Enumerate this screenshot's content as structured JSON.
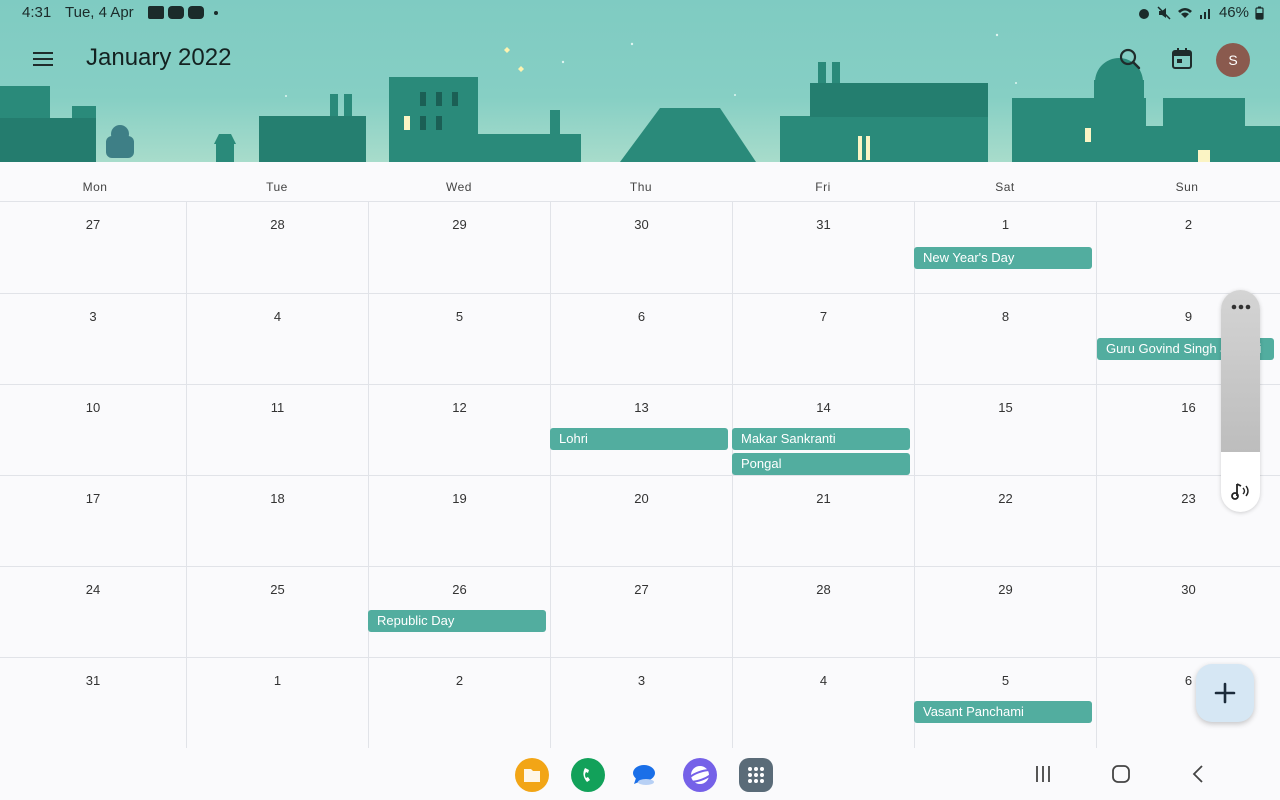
{
  "status_bar": {
    "time": "4:31",
    "date": "Tue, 4 Apr",
    "battery": "46%"
  },
  "header": {
    "title": "January 2022"
  },
  "weekdays": [
    "Mon",
    "Tue",
    "Wed",
    "Thu",
    "Fri",
    "Sat",
    "Sun"
  ],
  "weeks": [
    {
      "days": [
        "27",
        "28",
        "29",
        "30",
        "31",
        "1",
        "2"
      ]
    },
    {
      "days": [
        "3",
        "4",
        "5",
        "6",
        "7",
        "8",
        "9"
      ]
    },
    {
      "days": [
        "10",
        "11",
        "12",
        "13",
        "14",
        "15",
        "16"
      ]
    },
    {
      "days": [
        "17",
        "18",
        "19",
        "20",
        "21",
        "22",
        "23"
      ]
    },
    {
      "days": [
        "24",
        "25",
        "26",
        "27",
        "28",
        "29",
        "30"
      ]
    },
    {
      "days": [
        "31",
        "1",
        "2",
        "3",
        "4",
        "5",
        "6"
      ]
    }
  ],
  "events": [
    {
      "label": "New Year's Day"
    },
    {
      "label": "Guru Govind Singh Jayanti"
    },
    {
      "label": "Lohri"
    },
    {
      "label": "Makar Sankranti"
    },
    {
      "label": "Pongal"
    },
    {
      "label": "Republic Day"
    },
    {
      "label": "Vasant Panchami"
    }
  ],
  "colors": {
    "header_bg": "#86cfc4",
    "event_bg": "#52ad9f",
    "fab_bg": "#d6e7f4",
    "avatar_bg": "#8a5a4e"
  },
  "avatar": {
    "initial": "S"
  },
  "dock": [
    "my-files-icon",
    "phone-icon",
    "messages-icon",
    "internet-icon",
    "apps-icon"
  ]
}
